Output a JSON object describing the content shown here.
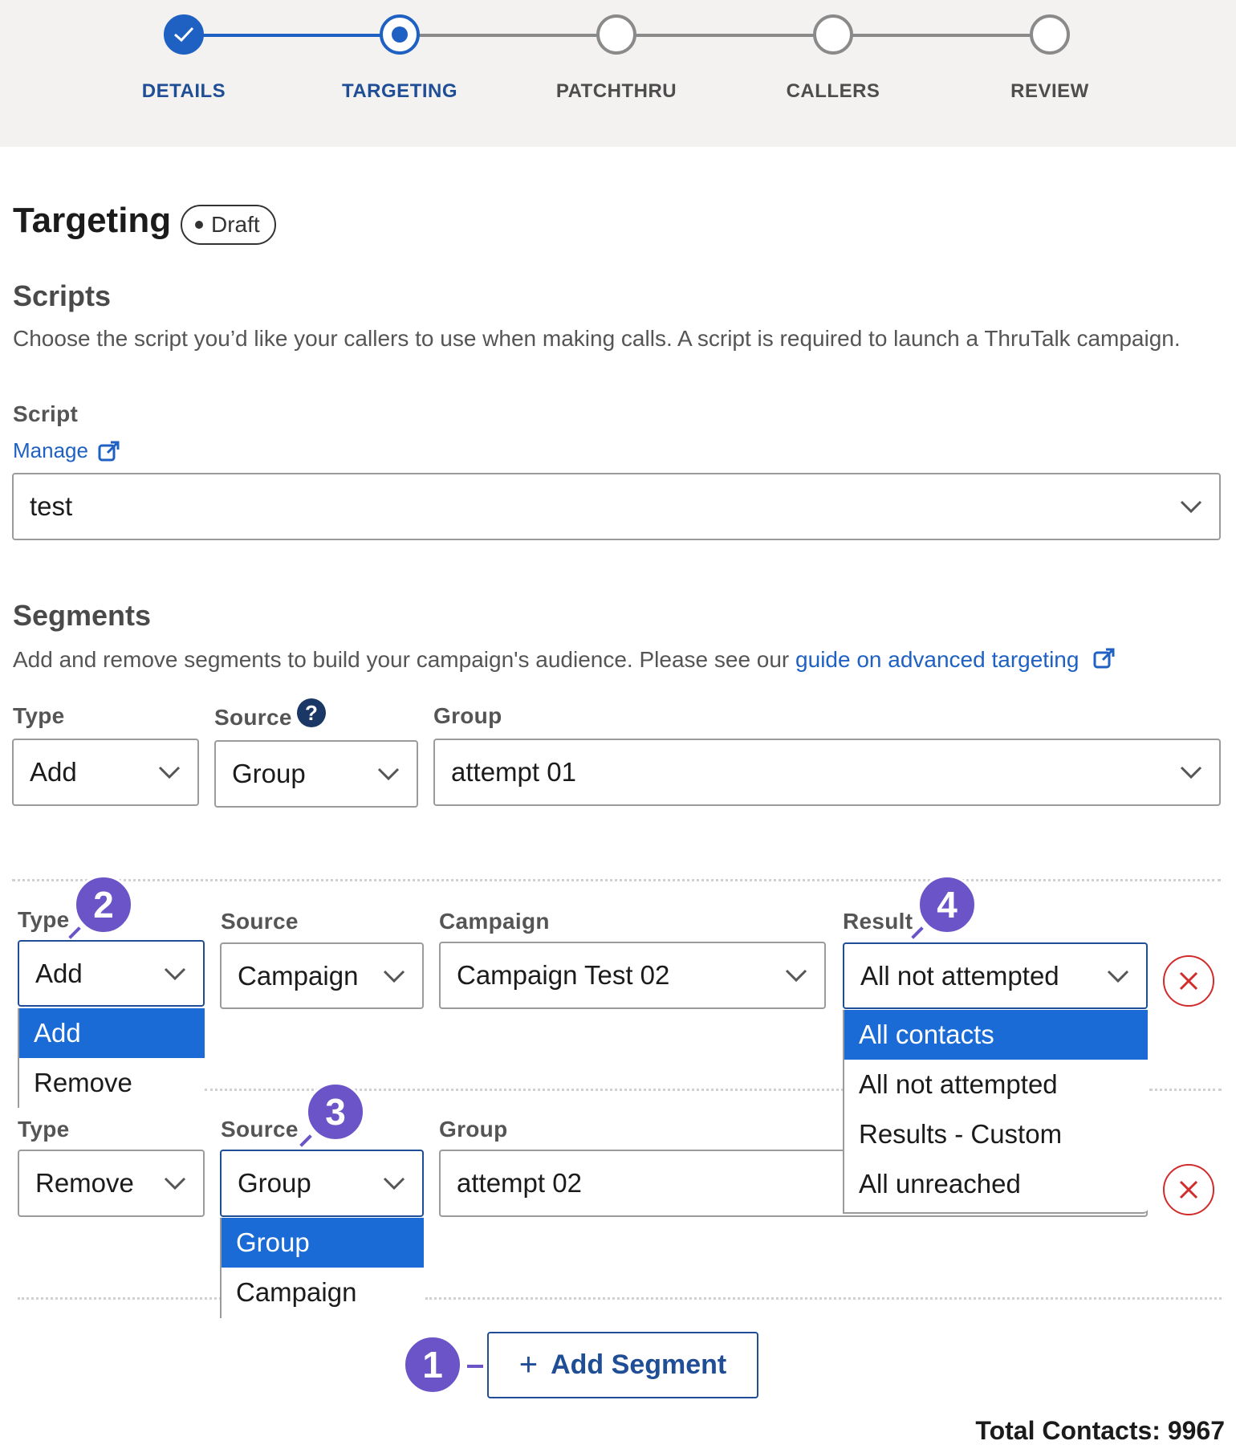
{
  "stepper": {
    "steps": [
      {
        "label": "DETAILS",
        "state": "done"
      },
      {
        "label": "TARGETING",
        "state": "current"
      },
      {
        "label": "PATCHTHRU",
        "state": "upcoming"
      },
      {
        "label": "CALLERS",
        "state": "upcoming"
      },
      {
        "label": "REVIEW",
        "state": "upcoming"
      }
    ]
  },
  "page": {
    "title": "Targeting",
    "status_badge": "Draft"
  },
  "scripts": {
    "heading": "Scripts",
    "description": "Choose the script you’d like your callers to use when making calls. A script is required to launch a ThruTalk campaign.",
    "field_label": "Script",
    "manage_link": "Manage",
    "selected": "test"
  },
  "segments": {
    "heading": "Segments",
    "description": "Add and remove segments to build your campaign's audience. Please see our ",
    "guide_link": "guide on advanced targeting",
    "rows": [
      {
        "type_label": "Type",
        "type_value": "Add",
        "source_label": "Source",
        "source_value": "Group",
        "group_label": "Group",
        "group_value": "attempt 01"
      },
      {
        "type_label": "Type",
        "type_value": "Add",
        "type_options": [
          "Add",
          "Remove"
        ],
        "source_label": "Source",
        "source_value": "Campaign",
        "campaign_label": "Campaign",
        "campaign_value": "Campaign Test 02",
        "result_label": "Result",
        "result_value": "All not attempted",
        "result_options": [
          "All contacts",
          "All not attempted",
          "Results - Custom",
          "All unreached"
        ]
      },
      {
        "type_label": "Type",
        "type_value": "Remove",
        "source_label": "Source",
        "source_value": "Group",
        "source_options": [
          "Group",
          "Campaign"
        ],
        "group_label": "Group",
        "group_value": "attempt 02"
      }
    ],
    "add_button": "Add Segment",
    "total_contacts": "Total Contacts: 9967"
  },
  "callouts": [
    "1",
    "2",
    "3",
    "4"
  ],
  "colors": {
    "primary": "#1f61c2",
    "menu_highlight": "#1a6bd6",
    "callout": "#6a54c8",
    "danger": "#d12b2b"
  }
}
